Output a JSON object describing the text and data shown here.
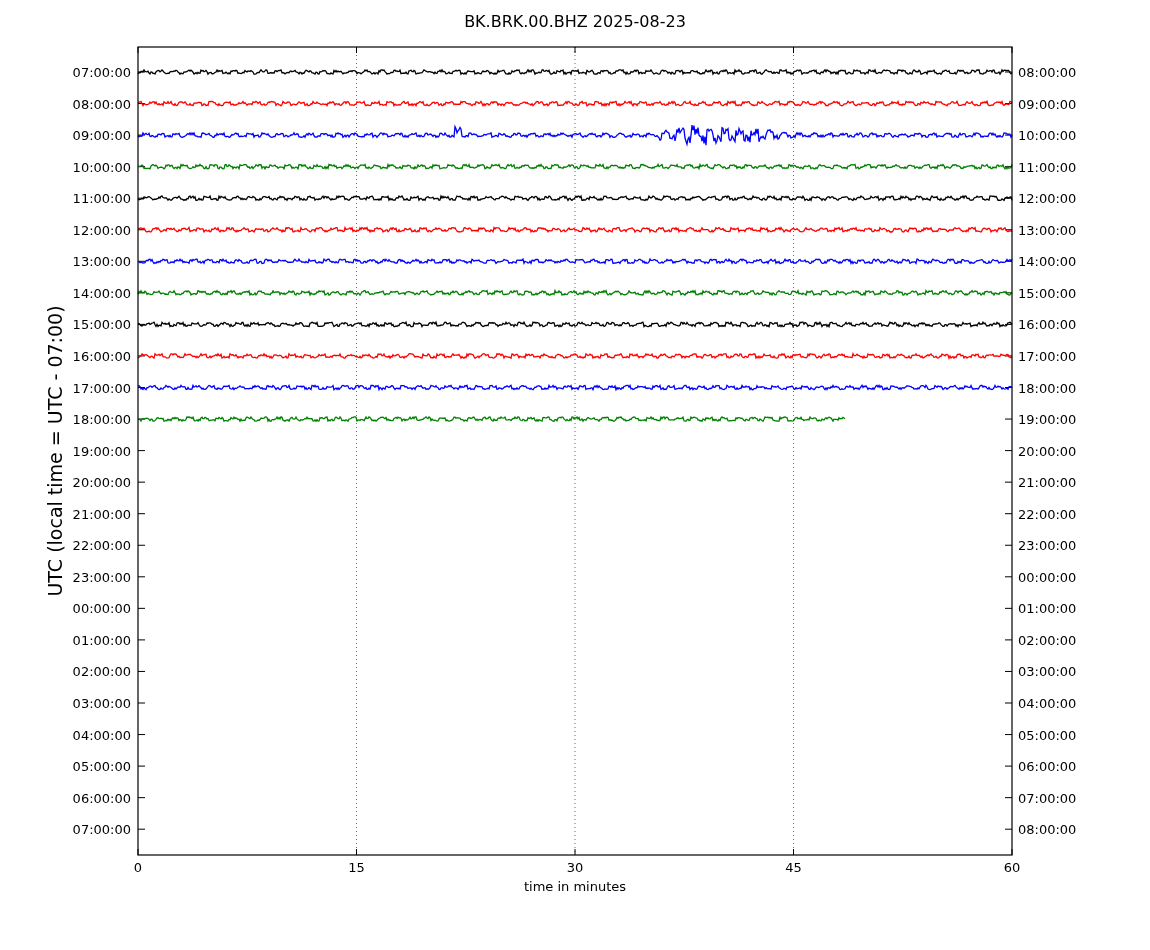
{
  "title": "BK.BRK.00.BHZ 2025-08-23",
  "ylabel": "UTC (local time = UTC - 07:00)",
  "xlabel": "time in minutes",
  "xticks": [
    "0",
    "15",
    "30",
    "45",
    "60"
  ],
  "left_ticks": [
    "07:00:00",
    "08:00:00",
    "09:00:00",
    "10:00:00",
    "11:00:00",
    "12:00:00",
    "13:00:00",
    "14:00:00",
    "15:00:00",
    "16:00:00",
    "17:00:00",
    "18:00:00",
    "19:00:00",
    "20:00:00",
    "21:00:00",
    "22:00:00",
    "23:00:00",
    "00:00:00",
    "01:00:00",
    "02:00:00",
    "03:00:00",
    "04:00:00",
    "05:00:00",
    "06:00:00",
    "07:00:00"
  ],
  "right_ticks": [
    "08:00:00",
    "09:00:00",
    "10:00:00",
    "11:00:00",
    "12:00:00",
    "13:00:00",
    "14:00:00",
    "15:00:00",
    "16:00:00",
    "17:00:00",
    "18:00:00",
    "19:00:00",
    "20:00:00",
    "21:00:00",
    "22:00:00",
    "23:00:00",
    "00:00:00",
    "01:00:00",
    "02:00:00",
    "03:00:00",
    "04:00:00",
    "05:00:00",
    "06:00:00",
    "07:00:00",
    "08:00:00"
  ],
  "traces": [
    {
      "color": "#000000",
      "kind": "quiet",
      "level": 1
    },
    {
      "color": "#ff0000",
      "kind": "quiet",
      "level": 1
    },
    {
      "color": "#0000ff",
      "kind": "event",
      "level": 1
    },
    {
      "color": "#008000",
      "kind": "quiet",
      "level": 1
    },
    {
      "color": "#000000",
      "kind": "quiet",
      "level": 1
    },
    {
      "color": "#ff0000",
      "kind": "quiet",
      "level": 1
    },
    {
      "color": "#0000ff",
      "kind": "quiet",
      "level": 1
    },
    {
      "color": "#008000",
      "kind": "quiet",
      "level": 1
    },
    {
      "color": "#000000",
      "kind": "quiet",
      "level": 1
    },
    {
      "color": "#ff0000",
      "kind": "quiet",
      "level": 1
    },
    {
      "color": "#0000ff",
      "kind": "quiet",
      "level": 1
    },
    {
      "color": "#008000",
      "kind": "quiet",
      "level": 0.81
    }
  ]
}
